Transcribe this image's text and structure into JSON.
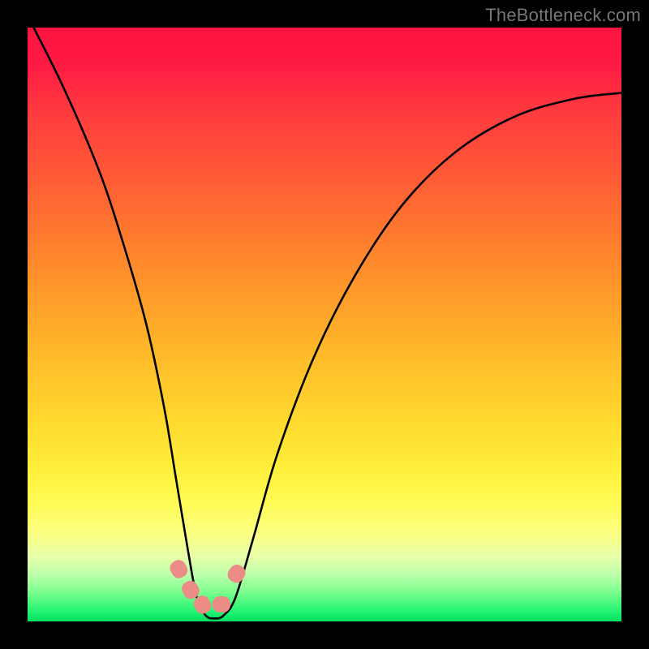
{
  "watermark": "TheBottleneck.com",
  "chart_data": {
    "type": "line",
    "title": "",
    "xlabel": "",
    "ylabel": "",
    "xlim": [
      0,
      100
    ],
    "ylim": [
      0,
      100
    ],
    "series": [
      {
        "name": "bottleneck-curve",
        "x": [
          0,
          6,
          12,
          16,
          20,
          23,
          25,
          27,
          28.5,
          30,
          31.5,
          33,
          35,
          38,
          42,
          48,
          55,
          63,
          72,
          82,
          92,
          100
        ],
        "values": [
          102,
          90,
          76,
          64,
          50,
          36,
          24,
          12,
          4,
          1,
          0.5,
          1,
          4,
          14,
          28,
          44,
          58,
          70,
          79,
          85,
          88,
          89
        ]
      }
    ],
    "markers": [
      {
        "name": "marker-a",
        "x": 25.5,
        "y": 9
      },
      {
        "name": "marker-b",
        "x": 27.5,
        "y": 5.5
      },
      {
        "name": "marker-c",
        "x": 29.5,
        "y": 3
      },
      {
        "name": "marker-d",
        "x": 32.5,
        "y": 3
      },
      {
        "name": "marker-e",
        "x": 35.0,
        "y": 8
      }
    ],
    "marker_color": "#eb8d86",
    "curve_color": "#000000"
  }
}
